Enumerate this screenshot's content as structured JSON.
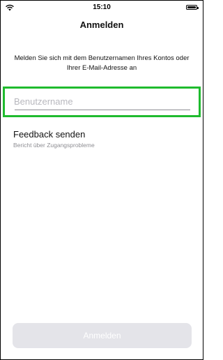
{
  "status_bar": {
    "time": "15:10",
    "wifi_icon": "wifi-icon",
    "battery_icon": "battery-icon"
  },
  "nav": {
    "title": "Anmelden"
  },
  "instruction": "Melden Sie sich mit dem Benutzernamen Ihres Kontos oder Ihrer E-Mail-Adresse an",
  "username_field": {
    "placeholder": "Benutzername",
    "value": ""
  },
  "feedback": {
    "title": "Feedback senden",
    "subtitle": "Bericht über Zugangsprobleme"
  },
  "login_button": {
    "label": "Anmelden",
    "enabled": false
  },
  "colors": {
    "focus_highlight": "#1fbb2e",
    "button_disabled_bg": "#e4e4e9",
    "placeholder": "#b8b8be",
    "secondary_text": "#8e8e93"
  }
}
